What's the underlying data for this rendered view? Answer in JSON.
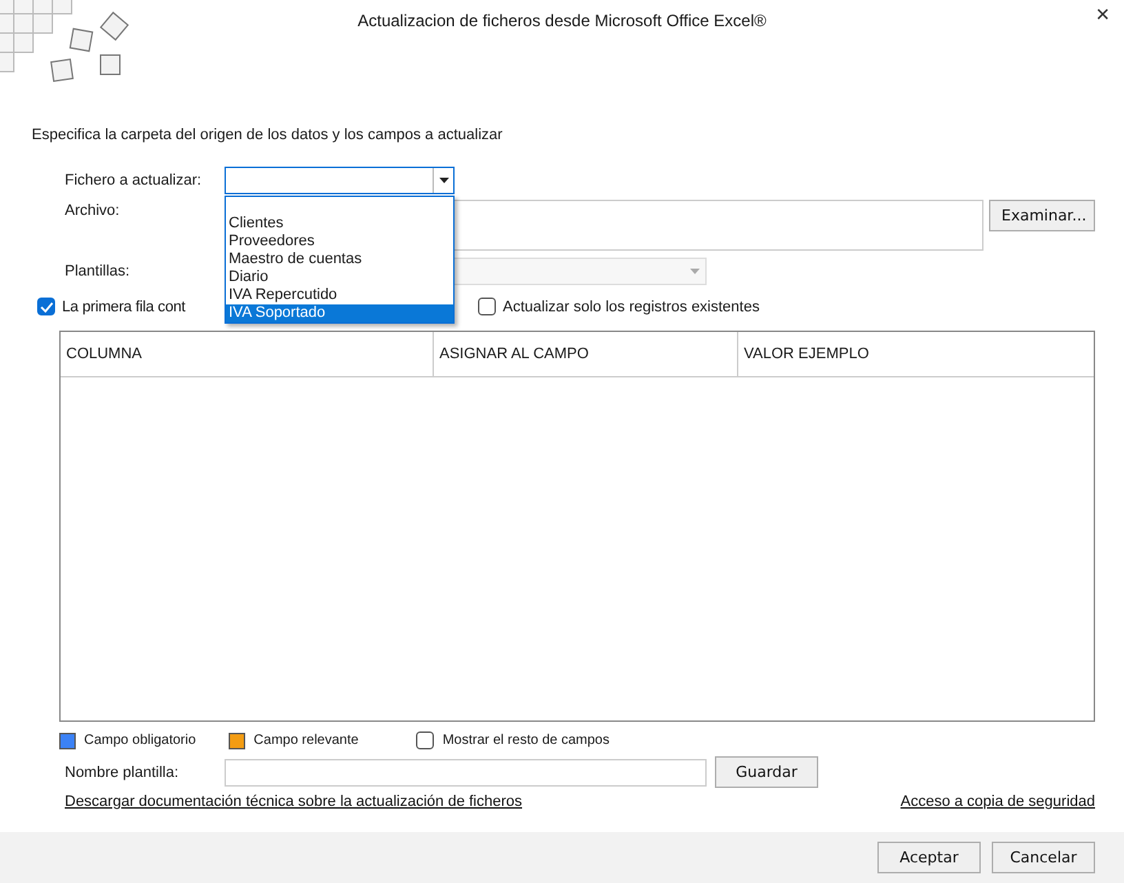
{
  "window": {
    "title": "Actualizacion de ficheros desde Microsoft Office Excel®",
    "close": "✕"
  },
  "instruction": "Especifica la carpeta del origen de los datos y los campos a actualizar",
  "form": {
    "fichero_label": "Fichero a actualizar:",
    "archivo_label": "Archivo:",
    "examinar": "Examinar...",
    "plantillas_label": "Plantillas:"
  },
  "dropdown": {
    "expanded": true,
    "options": [
      {
        "label": "Clientes",
        "selected": false
      },
      {
        "label": "Proveedores",
        "selected": false
      },
      {
        "label": "Maestro de cuentas",
        "selected": false
      },
      {
        "label": "Diario",
        "selected": false
      },
      {
        "label": "IVA Repercutido",
        "selected": false
      },
      {
        "label": "IVA Soportado",
        "selected": true
      }
    ]
  },
  "options": [
    {
      "label": "La primera fila cont",
      "checked": true
    },
    {
      "label": "Actualizar solo los registros existentes",
      "checked": false
    }
  ],
  "table": {
    "columns": [
      "COLUMNA",
      "ASIGNAR AL CAMPO",
      "VALOR EJEMPLO"
    ]
  },
  "legend": [
    {
      "label": "Campo obligatorio",
      "color": "#3b82f6"
    },
    {
      "label": "Campo relevante",
      "color": "#f39c12"
    }
  ],
  "show_rest": {
    "label": "Mostrar el resto de campos",
    "checked": false
  },
  "template": {
    "label": "Nombre plantilla:",
    "button": "Guardar"
  },
  "links": [
    "Descargar documentación técnica sobre la actualización de ficheros",
    "Acceso a copia de seguridad"
  ],
  "buttons": [
    "Aceptar",
    "Cancelar"
  ]
}
